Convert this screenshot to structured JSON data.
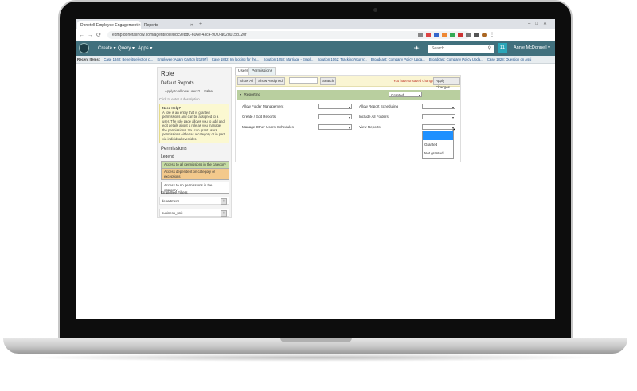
{
  "browser": {
    "tabs": [
      {
        "label": "Donetell Employee Engagement"
      },
      {
        "label": "Reports"
      }
    ],
    "url": "edmp.donetailnow.com/agent/role/bdc9e8d0-606e-43c4-90f0-a62d015d120f"
  },
  "app": {
    "menu": [
      "Create",
      "Query",
      "Apps"
    ],
    "search_placeholder": "Search",
    "badge": "11",
    "user_name": "Annie McDonnell"
  },
  "recent": {
    "label": "Recent Items:",
    "items": [
      "Case 1840: Benefits election p...",
      "Employee: Adam Carlton [21297]",
      "Case 1832: Im looking for the...",
      "Solution 1058: Marriage - Empl...",
      "Solution 1062: Tracking Your V...",
      "Broadcast: Company Policy Upda...",
      "Broadcast: Company Policy Upda...",
      "Case 1828: Question on Assi"
    ]
  },
  "left": {
    "title": "Role",
    "role_name": "Default Reports",
    "apply_label": "Apply to all new users?",
    "apply_value": "False",
    "description_prompt": "Click to enter a description",
    "help_title": "Need Help?",
    "help_text": "A role is an entity that is granted permissions and can be assigned to a user. The role page allows you to add and edit details about a role as you manage the permissions. You can grant users permissions either as a category or in part via individual overrides.",
    "permissions_label": "Permissions",
    "legend_label": "Legend",
    "legend": [
      {
        "text": "Access to all permissions in the category",
        "color": "#c6dca4"
      },
      {
        "text": "Access dependent on category or exceptions",
        "color": "#f3c98c"
      },
      {
        "text": "Access to no permissions in the category",
        "color": "#ffffff"
      }
    ],
    "filters_label": "Employee Filters",
    "filters": [
      "department",
      "business_unit"
    ]
  },
  "main": {
    "tabs": [
      "Users",
      "Permissions"
    ],
    "show_all": "Show All",
    "show_assigned": "Show Assigned",
    "search_button": "Search",
    "unsaved": "You have unsaved changes",
    "apply_changes": "Apply Changes",
    "section": "Reporting",
    "section_value": "Granted",
    "permissions_left": [
      "Allow Folder Management",
      "Create / Edit Reports",
      "Manage Other Users' Schedules"
    ],
    "permissions_right": [
      "Allow Report Scheduling",
      "Include All Folders",
      "View Reports"
    ],
    "dropdown_options": [
      "",
      "Granted",
      "Not granted"
    ]
  }
}
